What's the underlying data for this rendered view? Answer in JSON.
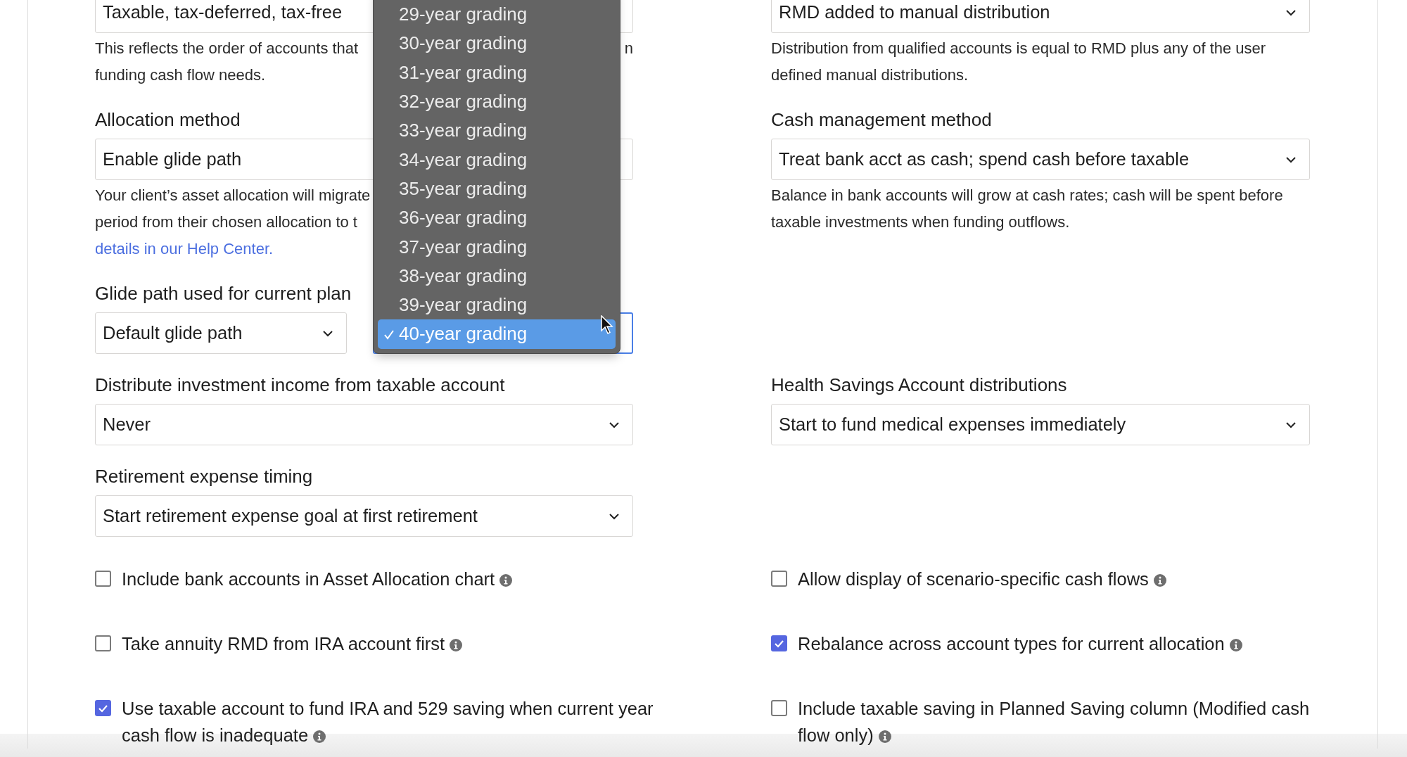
{
  "rows": [
    {
      "left": {
        "selects": [
          {
            "value": "Taxable, tax-deferred, tax-free",
            "focused": false
          }
        ],
        "help": [
          {
            "kind": "text",
            "text": "This reflects the order of accounts that",
            "tail": "n"
          },
          {
            "kind": "text",
            "text": "funding cash flow needs."
          }
        ]
      },
      "right": {
        "selects": [
          {
            "value": "RMD added to manual distribution",
            "focused": false
          }
        ],
        "help": [
          {
            "kind": "text",
            "text": "Distribution from qualified accounts is equal to RMD plus any of the user"
          },
          {
            "kind": "text",
            "text": "defined manual distributions."
          }
        ]
      }
    },
    {
      "left": {
        "label": "Allocation method",
        "selects": [
          {
            "value": "Enable glide path",
            "focused": false
          }
        ],
        "help": [
          {
            "kind": "text",
            "text": "Your client’s asset allocation will migrate"
          },
          {
            "kind": "text",
            "text": "period from their chosen allocation to t"
          },
          {
            "kind": "link",
            "text": "details in our Help Center."
          }
        ]
      },
      "right": {
        "label": "Cash management method",
        "selects": [
          {
            "value": "Treat bank acct as cash; spend cash before taxable",
            "focused": false
          }
        ],
        "help": [
          {
            "kind": "text",
            "text": "Balance in bank accounts will grow at cash rates; cash will be spent before"
          },
          {
            "kind": "text",
            "text": "taxable investments when funding outflows."
          }
        ]
      }
    },
    {
      "left": {
        "label": "Glide path used for current plan",
        "selects": [
          {
            "value": "Default glide path",
            "focused": false
          },
          {
            "focused": true
          }
        ]
      }
    },
    {
      "left": {
        "label": "Distribute investment income from taxable account",
        "selects": [
          {
            "value": "Never",
            "focused": false
          }
        ]
      },
      "right": {
        "label": "Health Savings Account distributions",
        "selects": [
          {
            "value": "Start to fund medical expenses immediately",
            "focused": false
          }
        ]
      }
    },
    {
      "left": {
        "label": "Retirement expense timing",
        "selects": [
          {
            "value": "Start retirement expense goal at first retirement",
            "focused": false
          }
        ]
      }
    }
  ],
  "checkboxes": [
    {
      "label": "Include bank accounts in Asset Allocation chart",
      "checked": false
    },
    {
      "label": "Allow display of scenario-specific cash flows",
      "checked": false
    },
    {
      "label": "Take annuity RMD from IRA account first",
      "checked": false
    },
    {
      "label": "Rebalance across account types for current allocation",
      "checked": true
    },
    {
      "label": "Use taxable account to fund IRA and 529 saving when current year cash flow is inadequate",
      "checked": true
    },
    {
      "label": "Include taxable saving in Planned Saving column (Modified cash flow only)",
      "checked": false
    }
  ],
  "dropdown": {
    "options": [
      {
        "label": "29-year grading",
        "selected": false
      },
      {
        "label": "30-year grading",
        "selected": false
      },
      {
        "label": "31-year grading",
        "selected": false
      },
      {
        "label": "32-year grading",
        "selected": false
      },
      {
        "label": "33-year grading",
        "selected": false
      },
      {
        "label": "34-year grading",
        "selected": false
      },
      {
        "label": "35-year grading",
        "selected": false
      },
      {
        "label": "36-year grading",
        "selected": false
      },
      {
        "label": "37-year grading",
        "selected": false
      },
      {
        "label": "38-year grading",
        "selected": false
      },
      {
        "label": "39-year grading",
        "selected": false
      },
      {
        "label": "40-year grading",
        "selected": true
      }
    ]
  }
}
